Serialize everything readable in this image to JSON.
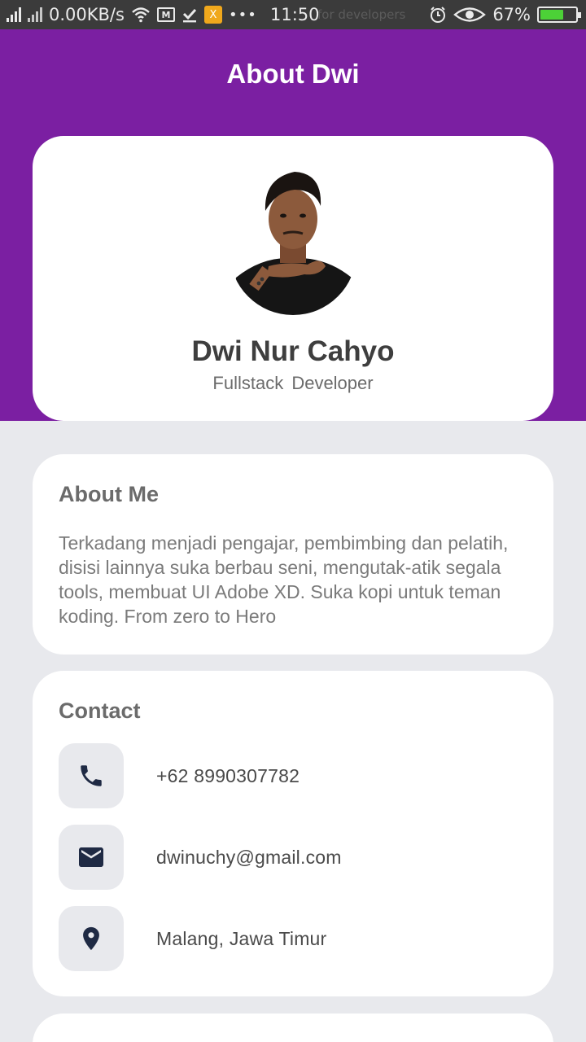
{
  "status_bar": {
    "speed": "0.00KB/s",
    "time": "11:50",
    "ghost_text": "for developers",
    "battery": "67%",
    "battery_level": 0.67,
    "icons": [
      "signal-icon",
      "signal-no-sim-icon",
      "wifi-icon",
      "gallery-icon",
      "check-icon",
      "app-notification-icon",
      "more-dots-icon",
      "alarm-icon",
      "eye-icon",
      "battery-icon"
    ]
  },
  "header": {
    "title": "About Dwi",
    "color": "#7b1fa2"
  },
  "profile": {
    "name": "Dwi Nur Cahyo",
    "role": "Fullstack  Developer"
  },
  "about": {
    "title": "About Me",
    "text": "Terkadang menjadi pengajar, pembimbing dan pelatih, disisi lainnya suka berbau seni, mengutak-atik segala tools, membuat UI Adobe XD. Suka kopi untuk teman koding. From zero to Hero"
  },
  "contact": {
    "title": "Contact",
    "items": [
      {
        "icon": "phone-icon",
        "text": "+62 8990307782"
      },
      {
        "icon": "email-icon",
        "text": "dwinuchy@gmail.com"
      },
      {
        "icon": "location-icon",
        "text": "Malang, Jawa Timur"
      }
    ]
  },
  "colors": {
    "icon": "#1f2a44",
    "background": "#e8e9ed",
    "card": "#ffffff"
  }
}
